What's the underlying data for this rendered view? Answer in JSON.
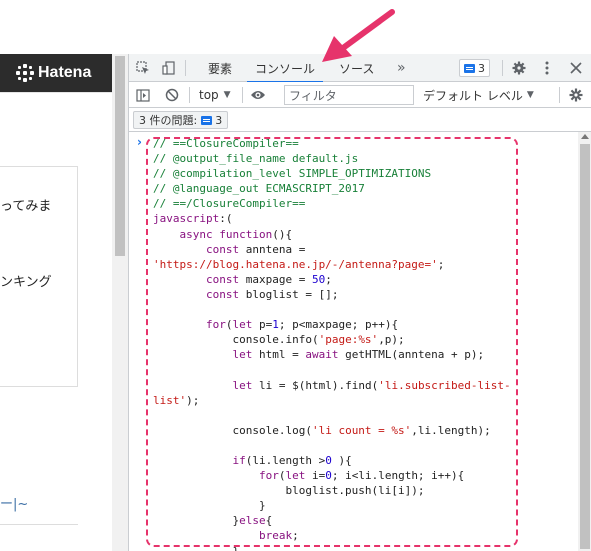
{
  "page": {
    "brand": "Hatena",
    "texts": [
      "ってみま",
      "ンキング",
      "ー|~"
    ]
  },
  "devtools": {
    "tabs": [
      {
        "label": "要素"
      },
      {
        "label": "コンソール"
      },
      {
        "label": "ソース"
      }
    ],
    "more_tabs": "»",
    "issues_badge_count": "3",
    "toolbar": {
      "context": "top",
      "filter_placeholder": "フィルタ",
      "levels": "デフォルト レベル"
    },
    "issues_button": {
      "label": "3 件の問題:",
      "count": "3"
    }
  },
  "console": {
    "lines": [
      [
        [
          "c",
          "// ==ClosureCompiler=="
        ]
      ],
      [
        [
          "c",
          "// @output_file_name default.js"
        ]
      ],
      [
        [
          "c",
          "// @compilation_level SIMPLE_OPTIMIZATIONS"
        ]
      ],
      [
        [
          "c",
          "// @language_out ECMASCRIPT_2017"
        ]
      ],
      [
        [
          "c",
          "// ==/ClosureCompiler=="
        ]
      ],
      [
        [
          "k",
          "javascript"
        ],
        [
          "p",
          ":("
        ]
      ],
      [
        [
          "p",
          "    "
        ],
        [
          "k",
          "async"
        ],
        [
          "p",
          " "
        ],
        [
          "k",
          "function"
        ],
        [
          "p",
          "(){"
        ]
      ],
      [
        [
          "p",
          "        "
        ],
        [
          "k",
          "const"
        ],
        [
          "p",
          " anntena ="
        ]
      ],
      [
        [
          "s",
          "'https://blog.hatena.ne.jp/-/antenna?page='"
        ],
        [
          "p",
          ";"
        ]
      ],
      [
        [
          "p",
          "        "
        ],
        [
          "k",
          "const"
        ],
        [
          "p",
          " maxpage = "
        ],
        [
          "n",
          "50"
        ],
        [
          "p",
          ";"
        ]
      ],
      [
        [
          "p",
          "        "
        ],
        [
          "k",
          "const"
        ],
        [
          "p",
          " bloglist = [];"
        ]
      ],
      [
        [
          "p",
          ""
        ]
      ],
      [
        [
          "p",
          "        "
        ],
        [
          "k",
          "for"
        ],
        [
          "p",
          "("
        ],
        [
          "k",
          "let"
        ],
        [
          "p",
          " p="
        ],
        [
          "n",
          "1"
        ],
        [
          "p",
          "; p<maxpage; p++){"
        ]
      ],
      [
        [
          "p",
          "            console.info("
        ],
        [
          "s",
          "'page:%s'"
        ],
        [
          "p",
          ",p);"
        ]
      ],
      [
        [
          "p",
          "            "
        ],
        [
          "k",
          "let"
        ],
        [
          "p",
          " html = "
        ],
        [
          "k",
          "await"
        ],
        [
          "p",
          " getHTML(anntena + p);"
        ]
      ],
      [
        [
          "p",
          ""
        ]
      ],
      [
        [
          "p",
          "            "
        ],
        [
          "k",
          "let"
        ],
        [
          "p",
          " li = $(html).find("
        ],
        [
          "s",
          "'li.subscribed-list-"
        ]
      ],
      [
        [
          "s",
          "list'"
        ],
        [
          "p",
          ");"
        ]
      ],
      [
        [
          "p",
          ""
        ]
      ],
      [
        [
          "p",
          "            console.log("
        ],
        [
          "s",
          "'li count = %s'"
        ],
        [
          "p",
          ",li.length);"
        ]
      ],
      [
        [
          "p",
          ""
        ]
      ],
      [
        [
          "p",
          "            "
        ],
        [
          "k",
          "if"
        ],
        [
          "p",
          "(li.length >"
        ],
        [
          "n",
          "0"
        ],
        [
          "p",
          " ){"
        ]
      ],
      [
        [
          "p",
          "                "
        ],
        [
          "k",
          "for"
        ],
        [
          "p",
          "("
        ],
        [
          "k",
          "let"
        ],
        [
          "p",
          " i="
        ],
        [
          "n",
          "0"
        ],
        [
          "p",
          "; i<li.length; i++){"
        ]
      ],
      [
        [
          "p",
          "                    bloglist.push(li[i]);"
        ]
      ],
      [
        [
          "p",
          "                }"
        ]
      ],
      [
        [
          "p",
          "            }"
        ],
        [
          "k",
          "else"
        ],
        [
          "p",
          "{"
        ]
      ],
      [
        [
          "p",
          "                "
        ],
        [
          "k",
          "break"
        ],
        [
          "p",
          ";"
        ]
      ],
      [
        [
          "p",
          "            }"
        ]
      ],
      [
        [
          "p",
          "        }"
        ]
      ]
    ]
  },
  "colors": {
    "highlight": "#e6336b",
    "accent": "#1a73e8",
    "comment": "#188038",
    "keyword": "#881280",
    "string": "#c41a16",
    "number": "#1c00cf"
  },
  "icons": [
    "inspect-icon",
    "device-icon",
    "issues-icon",
    "gear-icon",
    "kebab-icon",
    "close-icon",
    "sidebar-icon",
    "clear-icon",
    "eye-icon",
    "caret-down-icon",
    "arrow-annotation"
  ]
}
